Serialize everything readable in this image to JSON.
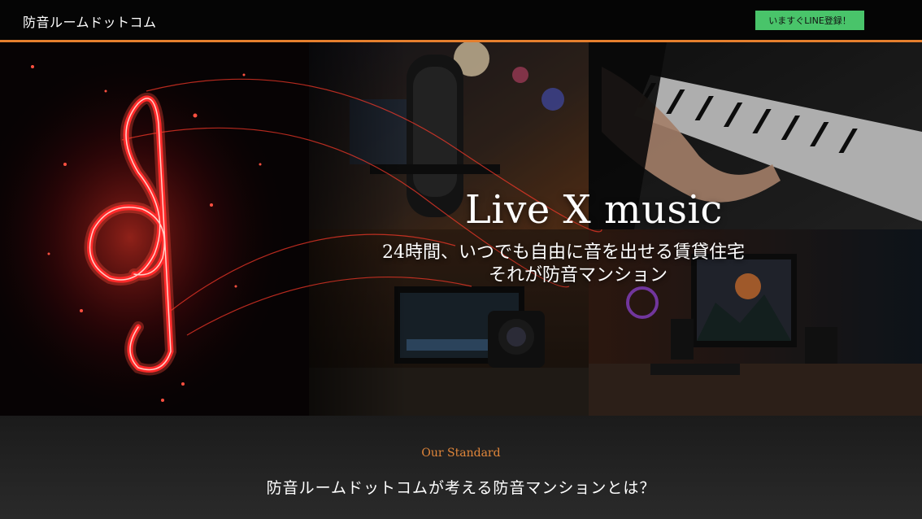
{
  "header": {
    "site_title": "防音ルームドットコム",
    "line_button_label": "いますぐLINE登録！"
  },
  "hero": {
    "title": "Live X music",
    "subtitle_line1": "24時間、いつでも自由に音を出せる賃貸住宅",
    "subtitle_line2": "それが防音マンション"
  },
  "standard_section": {
    "label": "Our Standard",
    "heading": "防音ルームドットコムが考える防音マンションとは？"
  },
  "colors": {
    "accent_orange": "#e57f2e",
    "line_green": "#49c46a",
    "treble_red": "#ff2a2a"
  },
  "icons": [
    "treble-clef-graphic",
    "microphone-photo",
    "piano-photo",
    "camera-editing-photo",
    "studio-monitor-photo"
  ]
}
